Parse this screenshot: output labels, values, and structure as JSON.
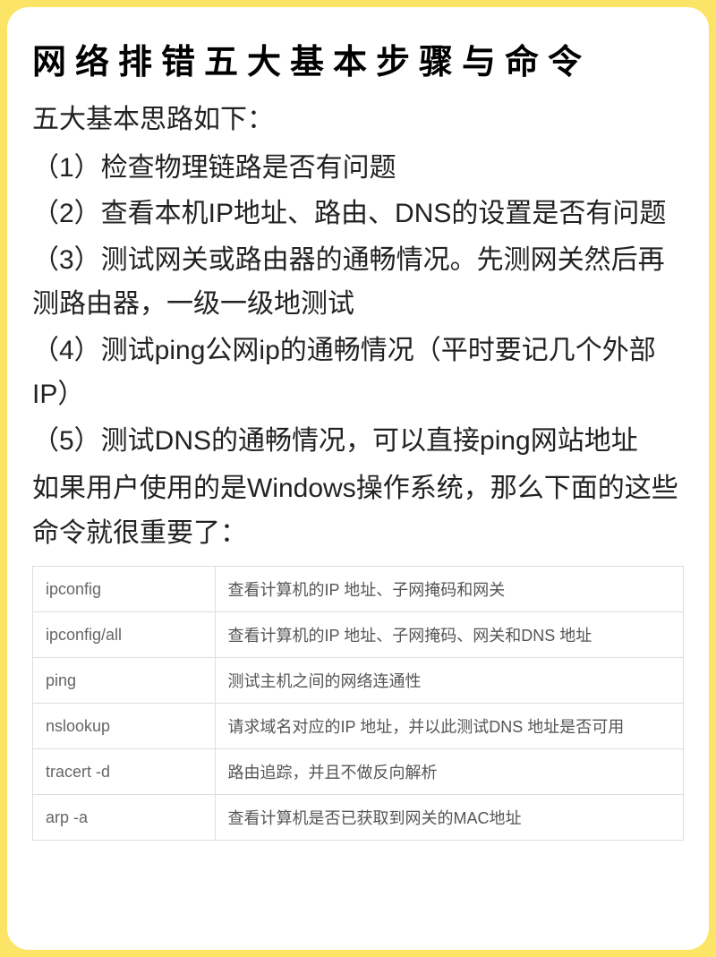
{
  "title": "网络排错五大基本步骤与命令",
  "intro": "五大基本思路如下：",
  "steps": [
    "（1）检查物理链路是否有问题",
    "（2）查看本机IP地址、路由、DNS的设置是否有问题",
    "（3）测试网关或路由器的通畅情况。先测网关然后再测路由器，一级一级地测试",
    "（4）测试ping公网ip的通畅情况（平时要记几个外部IP）",
    "（5）测试DNS的通畅情况，可以直接ping网站地址"
  ],
  "note": "如果用户使用的是Windows操作系统，那么下面的这些命令就很重要了：",
  "commands": [
    {
      "cmd": "ipconfig",
      "desc": "查看计算机的IP 地址、子网掩码和网关"
    },
    {
      "cmd": "ipconfig/all",
      "desc": "查看计算机的IP 地址、子网掩码、网关和DNS 地址"
    },
    {
      "cmd": "ping",
      "desc": "测试主机之间的网络连通性"
    },
    {
      "cmd": "nslookup",
      "desc": "请求域名对应的IP 地址，并以此测试DNS 地址是否可用"
    },
    {
      "cmd": "tracert -d",
      "desc": "路由追踪，并且不做反向解析"
    },
    {
      "cmd": "arp -a",
      "desc": "查看计算机是否已获取到网关的MAC地址"
    }
  ]
}
